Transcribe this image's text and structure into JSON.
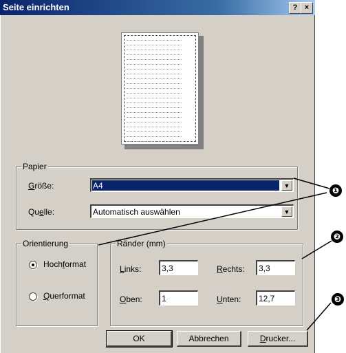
{
  "dialog": {
    "title": "Seite einrichten",
    "help_label": "?",
    "close_label": "×"
  },
  "papier": {
    "legend": "Papier",
    "size_label_pre": "",
    "size_label_u": "G",
    "size_label_post": "röße:",
    "size_value": "A4",
    "source_label_pre": "Qu",
    "source_label_u": "e",
    "source_label_post": "lle:",
    "source_value": "Automatisch auswählen",
    "dropdown_arrow": "▼"
  },
  "orientierung": {
    "legend": "Orientierung",
    "portrait_pre": "Hoch",
    "portrait_u": "f",
    "portrait_post": "ormat",
    "landscape_pre": "",
    "landscape_u": "Q",
    "landscape_post": "uerformat",
    "selected": "portrait"
  },
  "raender": {
    "legend": "Ränder (mm)",
    "left_u": "L",
    "left_post": "inks:",
    "left_value": "3,3",
    "right_u": "R",
    "right_post": "echts:",
    "right_value": "3,3",
    "top_u": "O",
    "top_post": "ben:",
    "top_value": "1",
    "bottom_u": "U",
    "bottom_post": "nten:",
    "bottom_value": "12,7"
  },
  "buttons": {
    "ok": "OK",
    "cancel": "Abbrechen",
    "printer_u": "D",
    "printer_post": "rucker..."
  },
  "callouts": [
    "❶",
    "❷",
    "❸"
  ],
  "colors": {
    "dialog_bg": "#d4d0c8",
    "title_start": "#0a246a",
    "selection": "#0a246a"
  }
}
